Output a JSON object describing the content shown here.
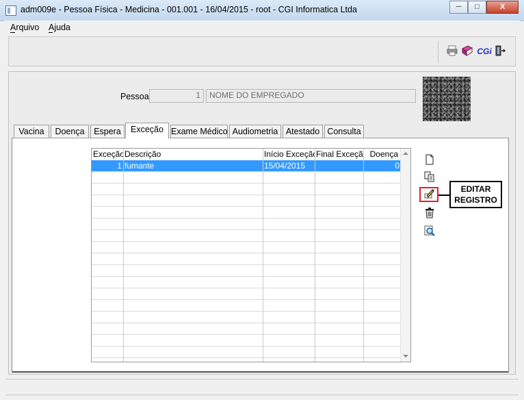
{
  "window": {
    "title": "adm009e - Pessoa Física - Medicina - 001.001 - 16/04/2015 - root - CGI Informatica Ltda",
    "minimize_glyph": "─",
    "maximize_glyph": "□",
    "close_glyph": "X"
  },
  "menu": {
    "arquivo": "Arquivo",
    "ajuda": "Ajuda"
  },
  "toolbar": {
    "icons": [
      "printer-icon",
      "book-icon",
      "cgi-logo-icon",
      "exit-door-icon"
    ],
    "cgi_label": "CGi"
  },
  "pessoa": {
    "label": "Pessoa:",
    "code": "1",
    "name": "NOME DO EMPREGADO"
  },
  "tabs": [
    {
      "label": "Vacina",
      "active": false
    },
    {
      "label": "Doença",
      "active": false
    },
    {
      "label": "Espera",
      "active": false
    },
    {
      "label": "Exceção",
      "active": true
    },
    {
      "label": "Exame Médico",
      "active": false
    },
    {
      "label": "Audiometria",
      "active": false
    },
    {
      "label": "Atestado",
      "active": false
    },
    {
      "label": "Consulta",
      "active": false
    }
  ],
  "grid": {
    "columns": [
      "Exceção",
      "Descrição",
      "Início Exceção",
      "Final Exceção",
      "Doença"
    ],
    "rows": [
      {
        "excecao": "1",
        "descricao": "fumante",
        "inicio": "15/04/2015",
        "final": "",
        "doenca": "0"
      }
    ],
    "empty_rows": 17
  },
  "side_actions": [
    "new-document-icon",
    "copy-icon",
    "edit-icon",
    "delete-icon",
    "search-icon"
  ],
  "callout": {
    "line1": "EDITAR",
    "line2": "REGISTRO"
  },
  "colors": {
    "selection": "#3399ff",
    "highlight_border": "#e0202a"
  }
}
